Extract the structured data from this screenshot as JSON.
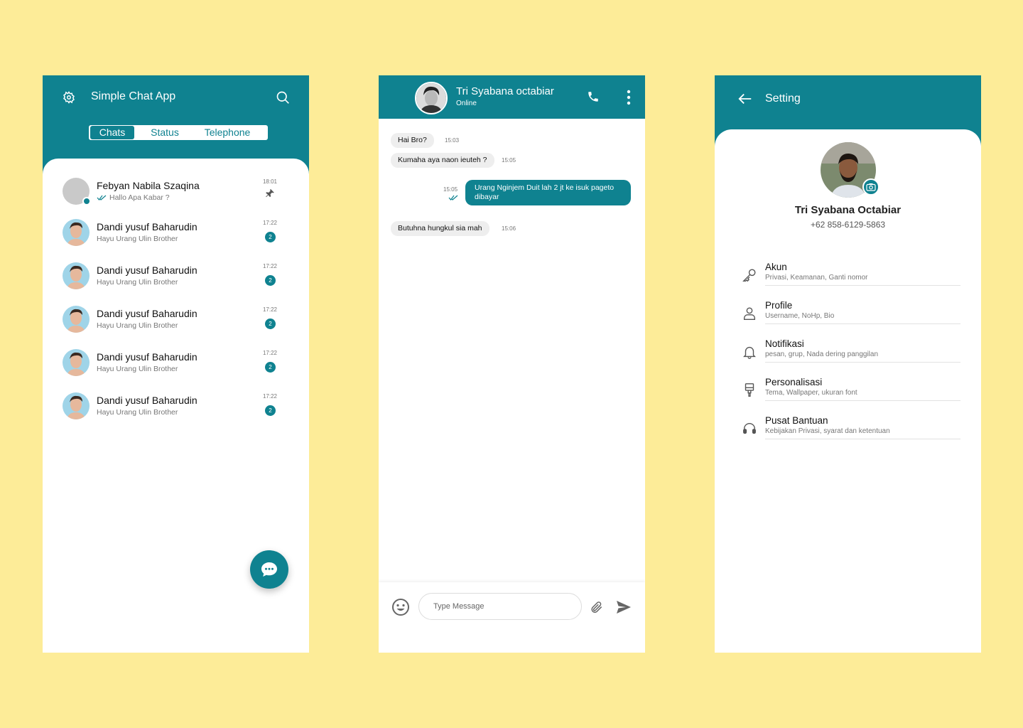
{
  "colors": {
    "background": "#fdec98",
    "accent": "#0f8290"
  },
  "chat_list": {
    "title": "Simple Chat App",
    "tabs": [
      {
        "label": "Chats",
        "active": true
      },
      {
        "label": "Status",
        "active": false
      },
      {
        "label": "Telephone",
        "active": false
      }
    ],
    "chats": [
      {
        "name": "Febyan Nabila Szaqina",
        "message": "Hallo Apa Kabar ?",
        "time": "18:01",
        "pinned": true,
        "read": true,
        "online": true
      },
      {
        "name": "Dandi yusuf Baharudin",
        "message": "Hayu Urang Ulin Brother",
        "time": "17:22",
        "unread": "2"
      },
      {
        "name": "Dandi yusuf Baharudin",
        "message": "Hayu Urang Ulin Brother",
        "time": "17:22",
        "unread": "2"
      },
      {
        "name": "Dandi yusuf Baharudin",
        "message": "Hayu Urang Ulin Brother",
        "time": "17:22",
        "unread": "2"
      },
      {
        "name": "Dandi yusuf Baharudin",
        "message": "Hayu Urang Ulin Brother",
        "time": "17:22",
        "unread": "2"
      },
      {
        "name": "Dandi yusuf Baharudin",
        "message": "Hayu Urang Ulin Brother",
        "time": "17:22",
        "unread": "2"
      }
    ]
  },
  "conversation": {
    "contact_name": "Tri Syabana octabiar",
    "contact_status": "Online",
    "messages": [
      {
        "direction": "in",
        "text": "Hai Bro?",
        "time": "15:03"
      },
      {
        "direction": "in",
        "text": "Kumaha aya naon ieuteh ?",
        "time": "15:05"
      },
      {
        "direction": "out",
        "text": "Urang Nginjem Duit lah 2 jt ke isuk pageto dibayar",
        "time": "15:05",
        "read": true
      },
      {
        "direction": "in",
        "text": "Butuhna hungkul sia mah",
        "time": "15:06"
      }
    ],
    "input_placeholder": "Type Message"
  },
  "settings": {
    "title": "Setting",
    "profile_name": "Tri Syabana Octabiar",
    "profile_phone": "+62 858-6129-5863",
    "items": [
      {
        "icon": "key-icon",
        "title": "Akun",
        "subtitle": "Privasi, Keamanan, Ganti nomor"
      },
      {
        "icon": "person-icon",
        "title": "Profile",
        "subtitle": "Username, NoHp, Bio"
      },
      {
        "icon": "bell-icon",
        "title": "Notifikasi",
        "subtitle": "pesan, grup, Nada dering panggilan"
      },
      {
        "icon": "paint-brush-icon",
        "title": "Personalisasi",
        "subtitle": "Tema, Wallpaper, ukuran font"
      },
      {
        "icon": "headset-icon",
        "title": "Pusat Bantuan",
        "subtitle": "Kebijakan Privasi, syarat dan ketentuan"
      }
    ]
  }
}
